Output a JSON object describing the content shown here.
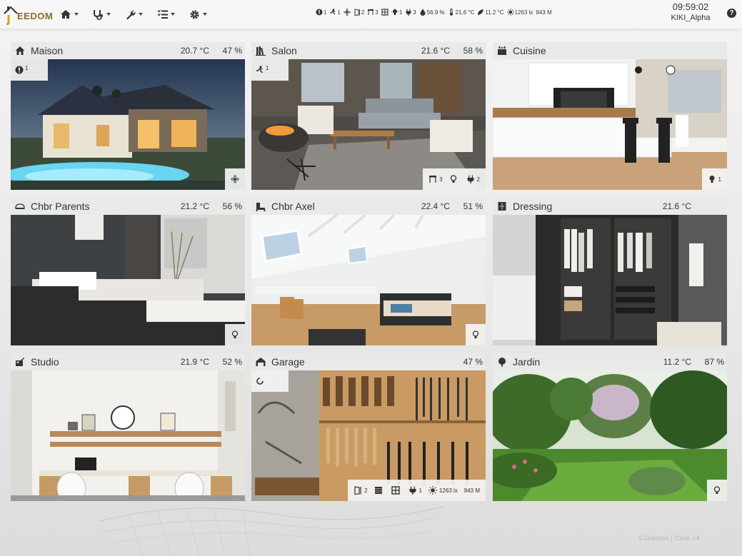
{
  "brand": {
    "name": "EEDOM"
  },
  "nav": {
    "items": [
      {
        "icon": "home-icon"
      },
      {
        "icon": "stethoscope-icon"
      },
      {
        "icon": "wrench-icon"
      },
      {
        "icon": "list-icon"
      },
      {
        "icon": "gear-icon"
      }
    ]
  },
  "summary": {
    "alerts": "1",
    "motion": "1",
    "fan": "",
    "doors": "2",
    "windows": "3",
    "shutters": "",
    "lights": "1",
    "outlets": "3",
    "humidity": "56.9 %",
    "temperature": "21.6 °C",
    "outdoor_temp": "11.2 °C",
    "luminosity": "1263 lx",
    "pressure": "943 M"
  },
  "clock": {
    "time": "09:59:02",
    "user": "KIKI_Alpha"
  },
  "rooms": [
    {
      "name": "Maison",
      "temp": "20.7 °C",
      "hum": "47 %",
      "icon": "house-icon",
      "tl_count": "1",
      "br": [
        {
          "icon": "fan-icon",
          "count": ""
        }
      ]
    },
    {
      "name": "Salon",
      "temp": "21.6 °C",
      "hum": "58 %",
      "icon": "books-icon",
      "tl_count": "1",
      "br": [
        {
          "icon": "window-icon",
          "count": "3"
        },
        {
          "icon": "bulb-icon",
          "count": ""
        },
        {
          "icon": "plug-icon",
          "count": "2"
        }
      ]
    },
    {
      "name": "Cuisine",
      "temp": "",
      "hum": "",
      "icon": "kitchen-icon",
      "br": [
        {
          "icon": "bulb-icon",
          "count": "1"
        }
      ]
    },
    {
      "name": "Chbr Parents",
      "temp": "21.2 °C",
      "hum": "56 %",
      "icon": "bed-icon",
      "br": [
        {
          "icon": "bulb-icon",
          "count": ""
        }
      ]
    },
    {
      "name": "Chbr Axel",
      "temp": "22.4 °C",
      "hum": "51 %",
      "icon": "bed-icon",
      "br": [
        {
          "icon": "bulb-icon",
          "count": ""
        }
      ]
    },
    {
      "name": "Dressing",
      "temp": "21.6 °C",
      "hum": "",
      "icon": "wardrobe-icon",
      "br": []
    },
    {
      "name": "Studio",
      "temp": "21.9 °C",
      "hum": "52 %",
      "icon": "studio-icon",
      "br": []
    },
    {
      "name": "Garage",
      "temp": "",
      "hum": "47 %",
      "icon": "garage-icon",
      "tl_icon": "refresh-icon",
      "br_text": {
        "door": "2",
        "plug": "1",
        "lux": "1263 lx",
        "pressure": "943 M"
      }
    },
    {
      "name": "Jardin",
      "temp": "11.2 °C",
      "hum": "87 %",
      "icon": "tree-icon",
      "br": [
        {
          "icon": "bulb-icon",
          "count": ""
        }
      ]
    }
  ],
  "footer": "©Jeedom | Core v4",
  "colors": {
    "brand": "#8a6d2a",
    "header_bg": "#e9e9e9",
    "navbar_bg": "#f7f7f7"
  }
}
